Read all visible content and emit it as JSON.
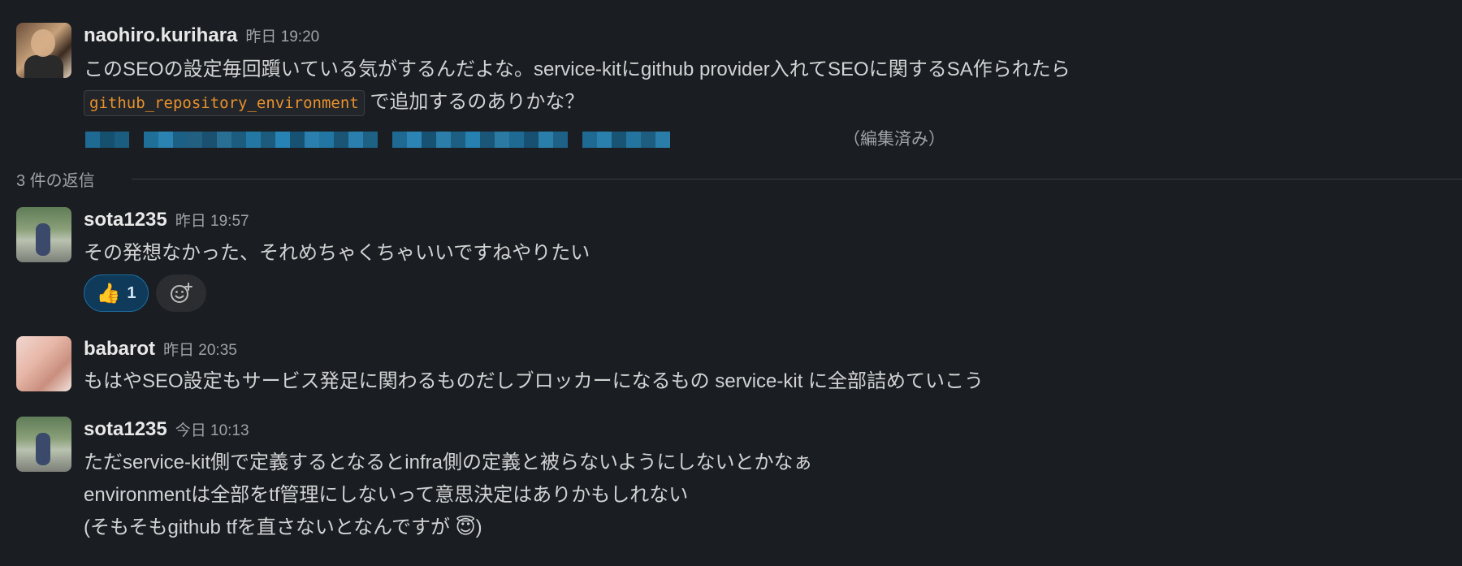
{
  "parent": {
    "author": "naohiro.kurihara",
    "time": "昨日 19:20",
    "text_line1": "このSEOの設定毎回躓いている気がするんだよな。service-kitにgithub provider入れてSEOに関するSA作られたら",
    "code": "github_repository_environment",
    "text_line2_after_code": "で追加するのありかな？",
    "edited_label": "（編集済み）"
  },
  "divider": {
    "label": "3 件の返信"
  },
  "replies": [
    {
      "author": "sota1235",
      "time": "昨日 19:57",
      "text": "その発想なかった、それめちゃくちゃいいですねやりたい",
      "reaction": {
        "emoji": "👍",
        "count": "1"
      },
      "add_reaction_icon": "add-emoji-icon"
    },
    {
      "author": "babarot",
      "time": "昨日 20:35",
      "text": "もはやSEO設定もサービス発足に関わるものだしブロッカーになるもの service-kit に全部詰めていこう"
    },
    {
      "author": "sota1235",
      "time": "今日 10:13",
      "line1": "ただservice-kit側で定義するとなるとinfra側の定義と被らないようにしないとかなぁ",
      "line2": "environmentは全部をtf管理にしないって意思決定はありかもしれない",
      "line3": "(そもそもgithub tfを直さないとなんですが 😇)"
    }
  ],
  "colors": {
    "background": "#1a1d21",
    "text": "#d1d2d3",
    "code": "#e8912d",
    "reaction_bg": "#0f3a5a"
  }
}
